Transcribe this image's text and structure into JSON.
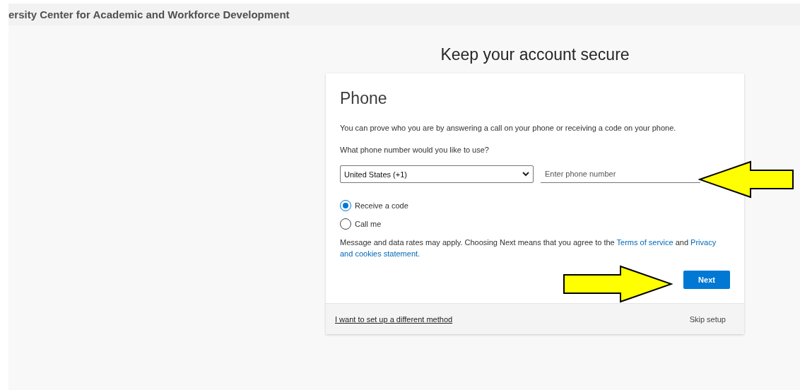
{
  "header": {
    "org_name": "ersity Center for Academic and Workforce Development"
  },
  "page_title": "Keep your account secure",
  "card": {
    "heading": "Phone",
    "intro": "You can prove who you are by answering a call on your phone or receiving a code on your phone.",
    "question": "What phone number would you like to use?",
    "country_select": {
      "value": "United States (+1)"
    },
    "phone_field": {
      "placeholder": "Enter phone number"
    },
    "options": [
      {
        "label": "Receive a code",
        "selected": true
      },
      {
        "label": "Call me",
        "selected": false
      }
    ],
    "notice": {
      "text": "Message and data rates may apply. Choosing Next means that you agree to the ",
      "terms_link": "Terms of service",
      "joiner": " and ",
      "privacy_link": "Privacy and cookies statement."
    },
    "next_button": "Next",
    "footer": {
      "different_method_link": "I want to set up a different method",
      "skip_link": "Skip setup"
    }
  },
  "annotations": [
    {
      "kind": "arrow-left"
    },
    {
      "kind": "arrow-right"
    }
  ]
}
